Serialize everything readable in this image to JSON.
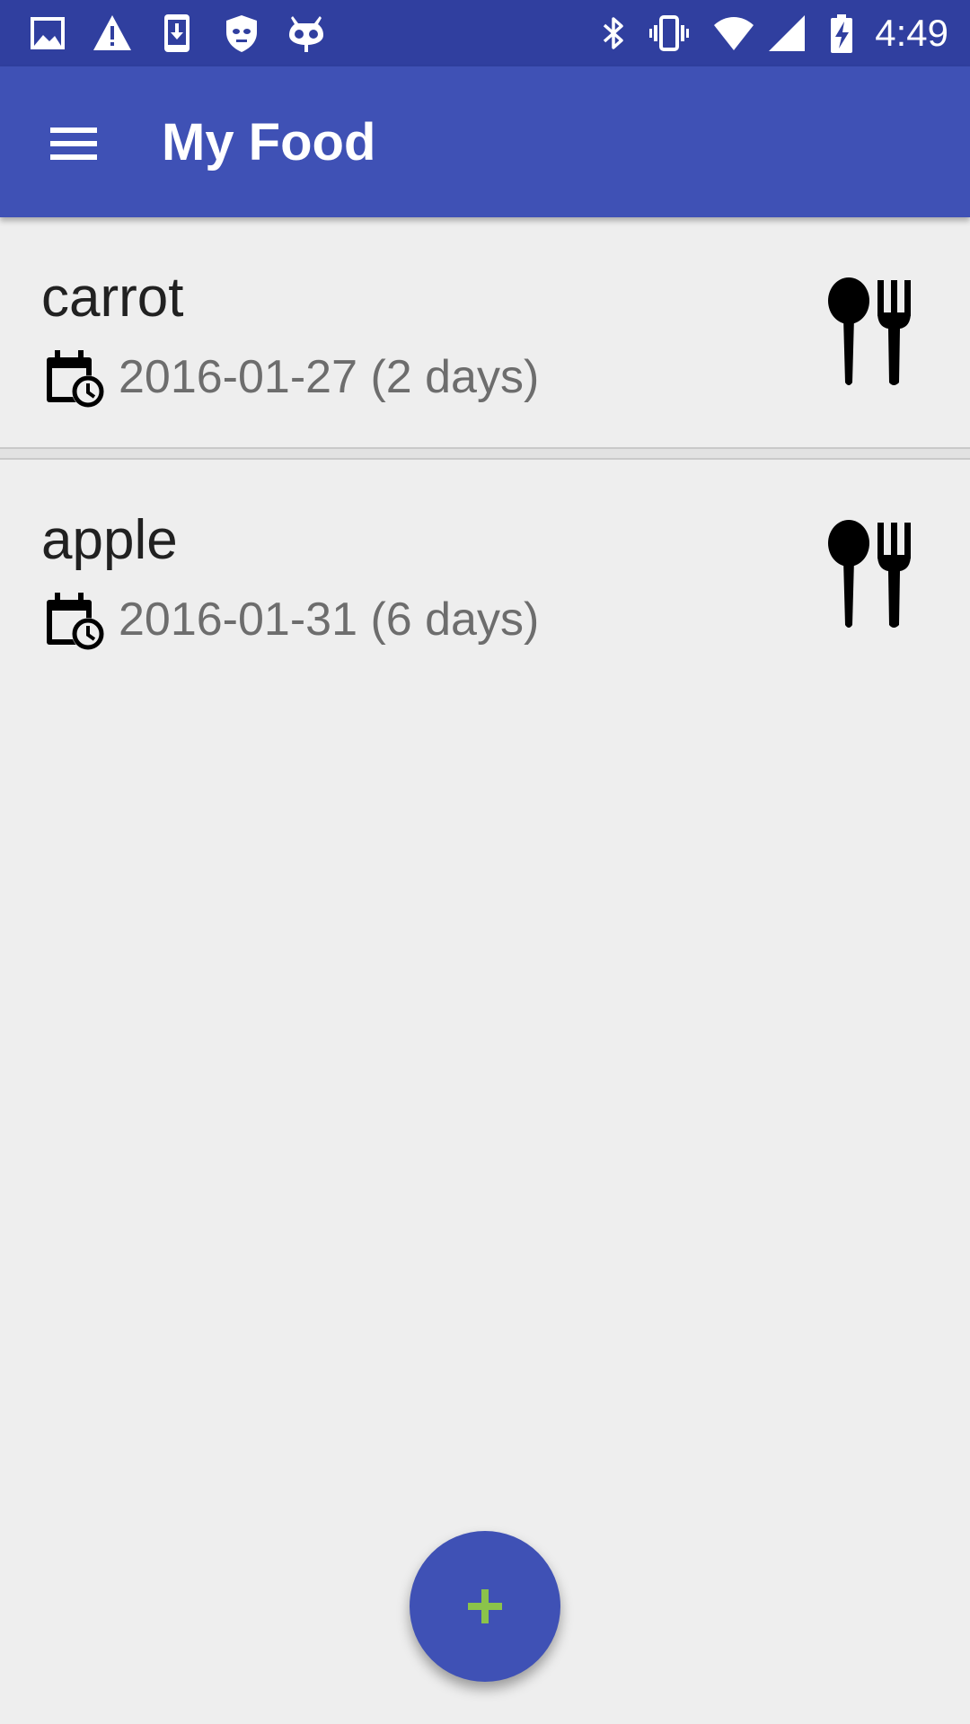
{
  "status_bar": {
    "time": "4:49",
    "left_icons": [
      "image-icon",
      "warning-icon",
      "download-icon",
      "shield-icon",
      "android-mascot-icon"
    ],
    "right_icons": [
      "bluetooth-icon",
      "vibrate-icon",
      "wifi-icon",
      "signal-icon",
      "battery-charging-icon"
    ],
    "background_color": "#303f9f"
  },
  "app_bar": {
    "title": "My Food",
    "menu_icon": "menu-icon",
    "background_color": "#3f51b5"
  },
  "food_items": [
    {
      "name": "carrot",
      "date": "2016-01-27 (2 days)",
      "icon": "calendar-clock-icon",
      "action_icon": "spoon-fork-icon"
    },
    {
      "name": "apple",
      "date": "2016-01-31 (6 days)",
      "icon": "calendar-clock-icon",
      "action_icon": "spoon-fork-icon"
    }
  ],
  "fab": {
    "icon": "plus-icon",
    "background_color": "#3f51b5",
    "icon_color": "#8bc34a"
  }
}
